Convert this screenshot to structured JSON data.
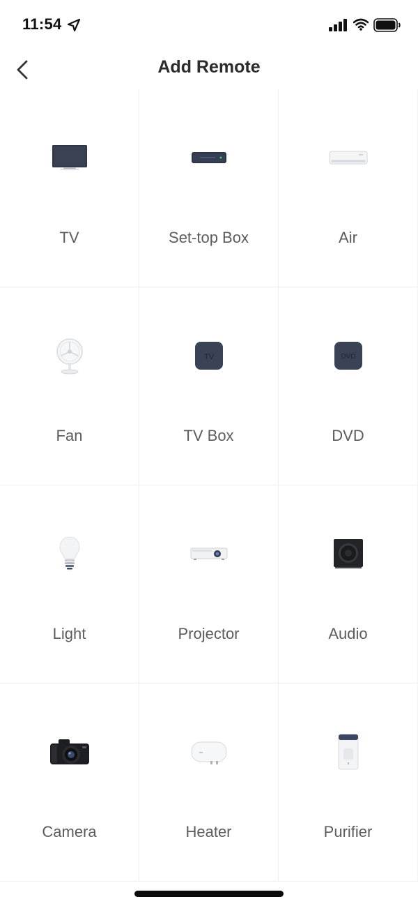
{
  "status_bar": {
    "time": "11:54"
  },
  "nav": {
    "title": "Add Remote"
  },
  "devices": [
    {
      "label": "TV",
      "icon": "tv-icon"
    },
    {
      "label": "Set-top Box",
      "icon": "set-top-box-icon"
    },
    {
      "label": "Air",
      "icon": "air-conditioner-icon"
    },
    {
      "label": "Fan",
      "icon": "fan-icon",
      "icon_text": ""
    },
    {
      "label": "TV Box",
      "icon": "tv-box-icon",
      "icon_text": "TV"
    },
    {
      "label": "DVD",
      "icon": "dvd-icon",
      "icon_text": "DVD"
    },
    {
      "label": "Light",
      "icon": "light-bulb-icon"
    },
    {
      "label": "Projector",
      "icon": "projector-icon"
    },
    {
      "label": "Audio",
      "icon": "speaker-icon"
    },
    {
      "label": "Camera",
      "icon": "camera-icon"
    },
    {
      "label": "Heater",
      "icon": "water-heater-icon"
    },
    {
      "label": "Purifier",
      "icon": "air-purifier-icon"
    }
  ]
}
